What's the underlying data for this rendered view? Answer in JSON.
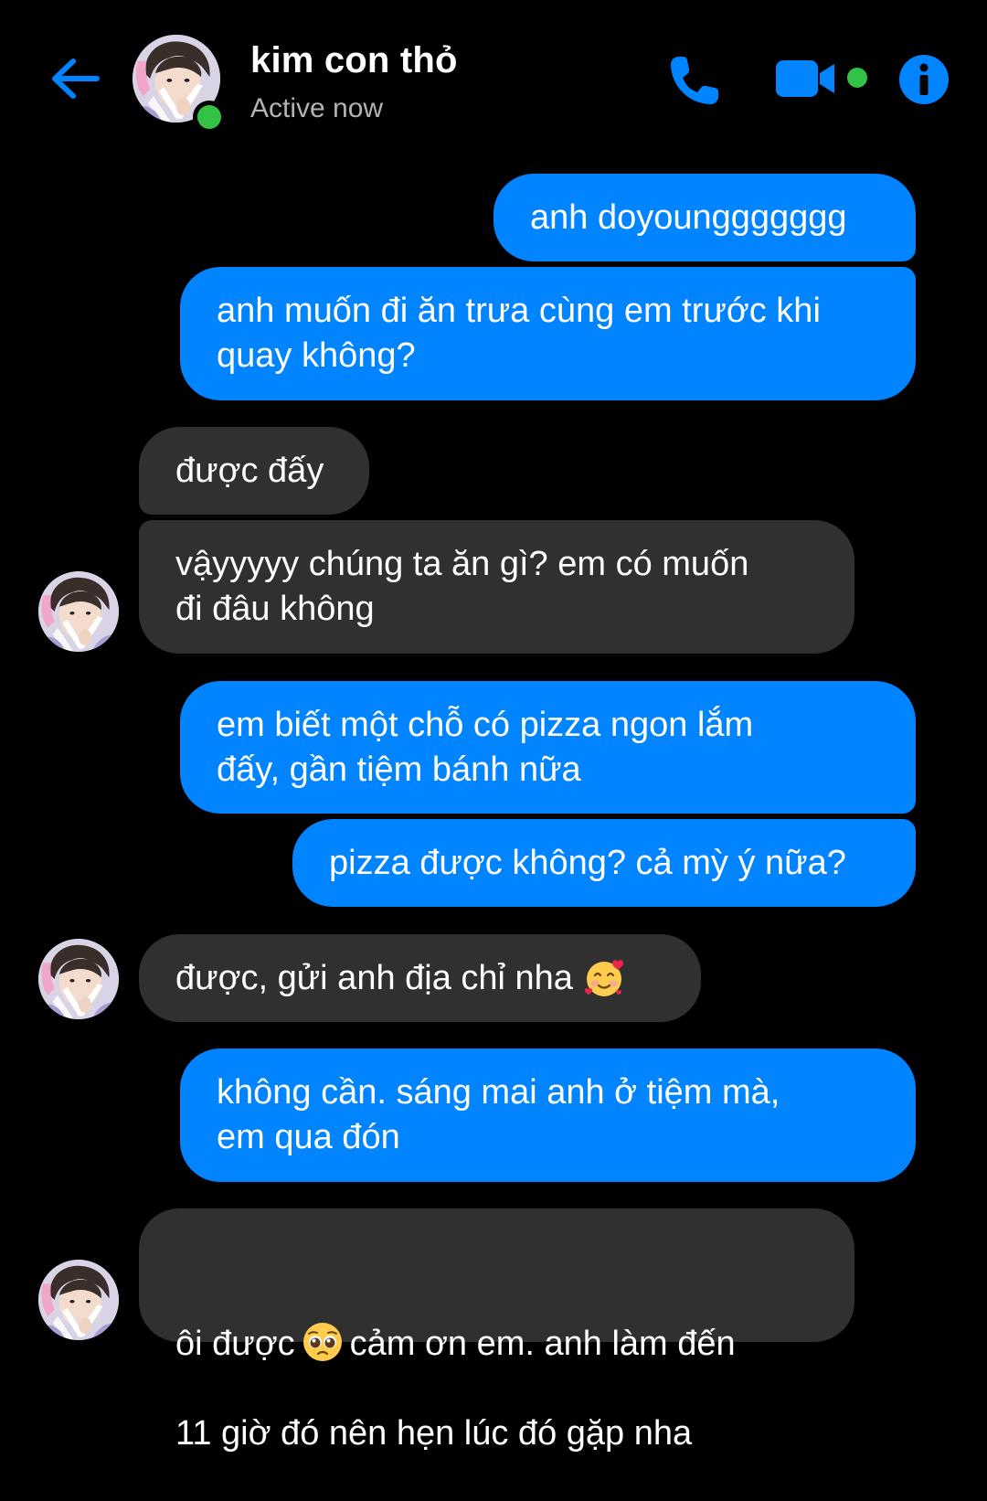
{
  "header": {
    "contact_name": "kim con thỏ",
    "status": "Active now",
    "accent_color": "#0084ff",
    "active_color": "#31c246"
  },
  "messages": [
    {
      "sender": "me",
      "text": "anh doyounggggggg"
    },
    {
      "sender": "me",
      "text": "anh muốn đi ăn trưa cùng em trước khi\nquay không?"
    },
    {
      "sender": "them",
      "text": "được đấy"
    },
    {
      "sender": "them",
      "text": "vậyyyyy chúng ta ăn gì? em có muốn\nđi đâu không"
    },
    {
      "sender": "me",
      "text": "em biết một chỗ có pizza ngon lắm\nđấy, gần tiệm bánh nữa"
    },
    {
      "sender": "me",
      "text": "pizza được không? cả mỳ ý nữa?"
    },
    {
      "sender": "them",
      "text": "được, gửi anh địa chỉ nha",
      "emoji": "smiling-face-with-hearts"
    },
    {
      "sender": "me",
      "text": "không cần. sáng mai anh ở tiệm mà,\nem qua đón"
    },
    {
      "sender": "them",
      "text_before": "ôi được",
      "emoji": "pleading-face",
      "text_after": "cảm ơn em. anh làm đến",
      "text_line2": "11 giờ đó nên hẹn lúc đó gặp nha"
    }
  ],
  "colors": {
    "outgoing_bubble": "#0084ff",
    "incoming_bubble": "#303030",
    "background": "#000000"
  }
}
